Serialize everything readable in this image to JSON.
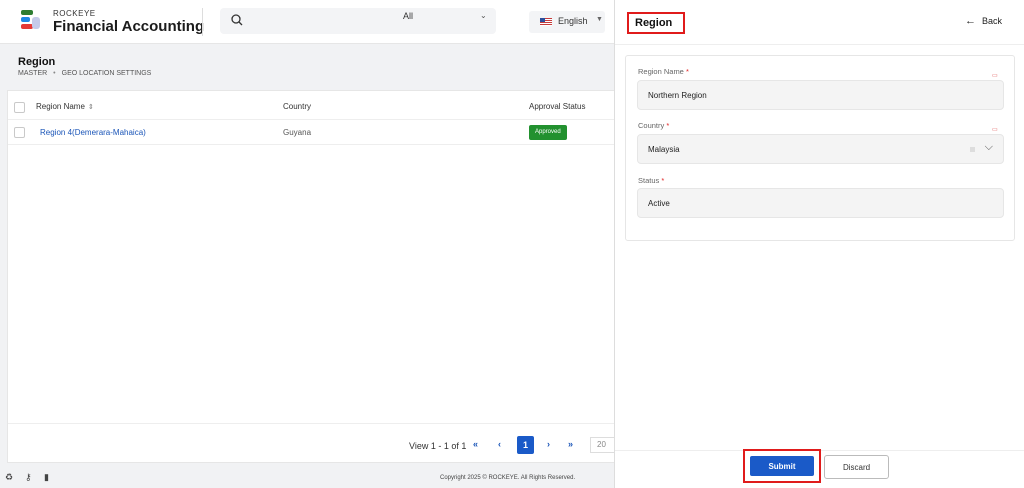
{
  "header": {
    "brand_small": "ROCKEYE",
    "brand_name": "Financial Accounting",
    "search": {
      "placeholder": "",
      "scope": "All"
    },
    "language": "English"
  },
  "page": {
    "title": "Region",
    "breadcrumbs": [
      "MASTER",
      "GEO LOCATION SETTINGS"
    ]
  },
  "table": {
    "columns": [
      "Region Name",
      "Country",
      "Approval Status"
    ],
    "rows": [
      {
        "region": "Region 4(Demerara-Mahaica)",
        "country": "Guyana",
        "status": "Approved"
      }
    ],
    "status_colors": {
      "Approved": "#22912f"
    }
  },
  "pagination": {
    "view_text": "View 1 - 1 of 1",
    "current_page": "1",
    "page_size": "20"
  },
  "footer": {
    "copyright": "Copyright 2025 © ROCKEYE. All Rights Reserved."
  },
  "panel": {
    "title": "Region",
    "back_label": "Back",
    "fields": {
      "region_name": {
        "label": "Region Name",
        "value": "Northern Region"
      },
      "country": {
        "label": "Country",
        "value": "Malaysia"
      },
      "status": {
        "label": "Status",
        "value": "Active"
      }
    },
    "submit_label": "Submit",
    "discard_label": "Discard"
  },
  "colors": {
    "accent": "#1a5ac8",
    "highlight": "#e01b1b"
  }
}
